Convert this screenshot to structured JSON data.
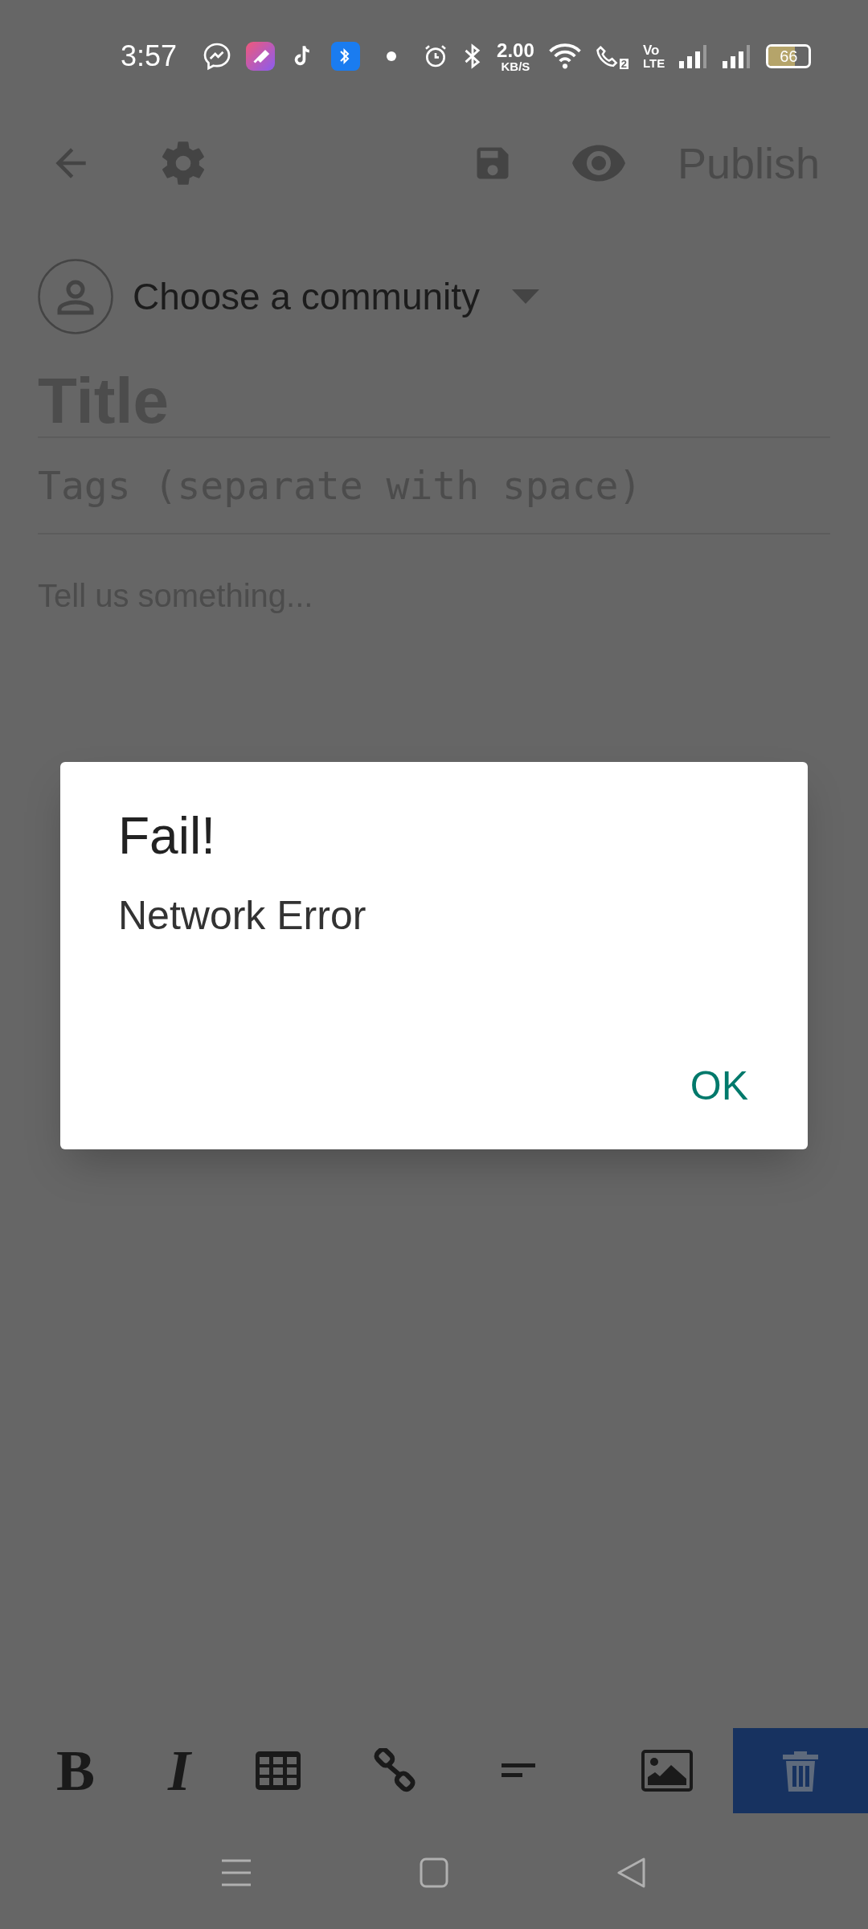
{
  "status_bar": {
    "time": "3:57",
    "speed_value": "2.00",
    "speed_unit": "KB/S",
    "call_sim": "2",
    "volte_top": "Vo",
    "volte_bottom": "LTE",
    "battery": "66"
  },
  "toolbar": {
    "publish": "Publish"
  },
  "community": {
    "label": "Choose a community"
  },
  "title_field": {
    "placeholder": "Title"
  },
  "tags_field": {
    "placeholder": "Tags (separate with space)"
  },
  "body_field": {
    "placeholder": "Tell us something..."
  },
  "dialog": {
    "title": "Fail!",
    "message": "Network Error",
    "button": "OK"
  },
  "format_bar": {
    "bold": "B",
    "italic": "I"
  }
}
